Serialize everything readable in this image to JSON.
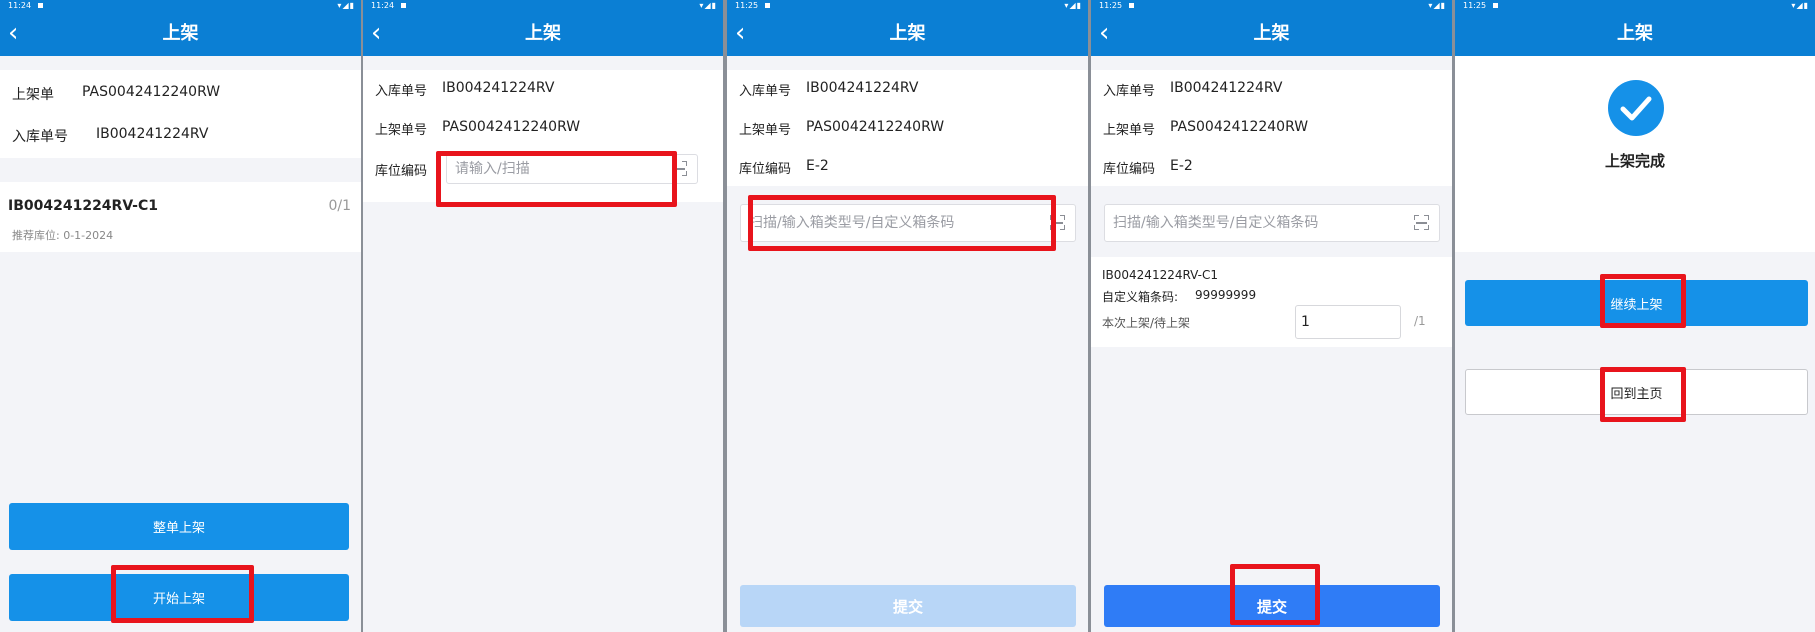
{
  "common": {
    "title": "上架",
    "back_glyph": "‹",
    "scan_icon": "scan-icon",
    "back_icon": "chevron-left-icon"
  },
  "panels": [
    {
      "time": "11:24",
      "fields": {
        "putaway_label": "上架单",
        "putaway_value": "PAS0042412240RW",
        "inbound_label": "入库单号",
        "inbound_value": "IB004241224RV"
      },
      "item": {
        "code": "IB004241224RV-C1",
        "progress": "0/1",
        "recommend": "推荐库位: 0-1-2024"
      },
      "buttons": {
        "whole": "整单上架",
        "start": "开始上架"
      }
    },
    {
      "time": "11:24",
      "fields": {
        "inbound_label": "入库单号",
        "inbound_value": "IB004241224RV",
        "putaway_label": "上架单号",
        "putaway_value": "PAS0042412240RW",
        "location_label": "库位编码",
        "location_placeholder": "请输入/扫描"
      }
    },
    {
      "time": "11:25",
      "fields": {
        "inbound_label": "入库单号",
        "inbound_value": "IB004241224RV",
        "putaway_label": "上架单号",
        "putaway_value": "PAS0042412240RW",
        "location_label": "库位编码",
        "location_value": "E-2",
        "scan_placeholder": "扫描/输入箱类型号/自定义箱条码"
      },
      "buttons": {
        "submit": "提交"
      }
    },
    {
      "time": "11:25",
      "fields": {
        "inbound_label": "入库单号",
        "inbound_value": "IB004241224RV",
        "putaway_label": "上架单号",
        "putaway_value": "PAS0042412240RW",
        "location_label": "库位编码",
        "location_value": "E-2",
        "scan_placeholder": "扫描/输入箱类型号/自定义箱条码"
      },
      "item": {
        "code": "IB004241224RV-C1",
        "barcode_label": "自定义箱条码:",
        "barcode_value": "99999999",
        "qty_label": "本次上架/待上架",
        "qty_value": "1",
        "qty_total": "/1"
      },
      "buttons": {
        "submit": "提交"
      }
    },
    {
      "time": "11:25",
      "done_text": "上架完成",
      "check_icon": "check-circle-icon",
      "buttons": {
        "continue": "继续上架",
        "home": "回到主页"
      }
    }
  ],
  "highlight_color": "#e8141c",
  "accent_color": "#0b7fd4"
}
